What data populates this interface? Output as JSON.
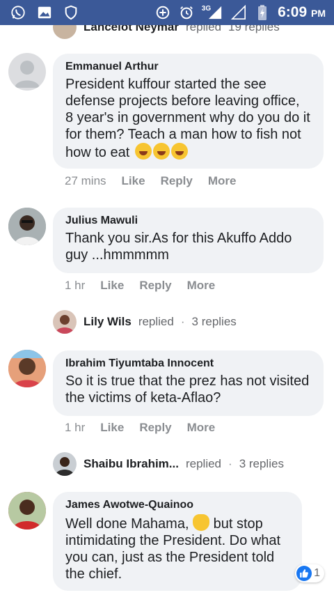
{
  "status_bar": {
    "time": "6:09",
    "ampm": "PM",
    "network": "3G",
    "icons": [
      "whatsapp-icon",
      "gallery-icon",
      "shield-icon",
      "data-saver-icon",
      "alarm-icon",
      "signal-icon",
      "battery-charging-icon"
    ]
  },
  "top_reply": {
    "name": "Lancelot Neymar",
    "action": "replied",
    "count": "19 replies"
  },
  "comments": [
    {
      "author": "Emmanuel Arthur",
      "text": "President kuffour started the see defense projects before leaving office, 8 year's in government why do you do it for them? Teach a man how to fish not how to eat",
      "emoji": "rolling-laughing-emoji x3",
      "time": "27 mins",
      "like": "Like",
      "reply": "Reply",
      "more": "More"
    },
    {
      "author": "Julius Mawuli",
      "text": "Thank you sir.As for this Akuffo Addo guy ...hmmmmm",
      "time": "1 hr",
      "like": "Like",
      "reply": "Reply",
      "more": "More",
      "reply_summary": {
        "name": "Lily Wils",
        "action": "replied",
        "dot": "·",
        "count": "3 replies"
      }
    },
    {
      "author": "Ibrahim Tiyumtaba Innocent",
      "text": "So it is true that the prez has not visited the victims of keta-Aflao?",
      "time": "1 hr",
      "like": "Like",
      "reply": "Reply",
      "more": "More",
      "reply_summary": {
        "name": "Shaibu Ibrahim...",
        "action": "replied",
        "dot": "·",
        "count": "3 replies"
      }
    },
    {
      "author": "James Awotwe-Quainoo",
      "text_part1": "Well done Mahama,",
      "text_part2": "but stop intimidating the President. Do what you can, just as the President told the chief.",
      "like_count": "1"
    }
  ],
  "colors": {
    "status_bar_bg": "#3b5998",
    "bubble_bg": "#f0f2f5",
    "like_blue": "#1877f2"
  }
}
